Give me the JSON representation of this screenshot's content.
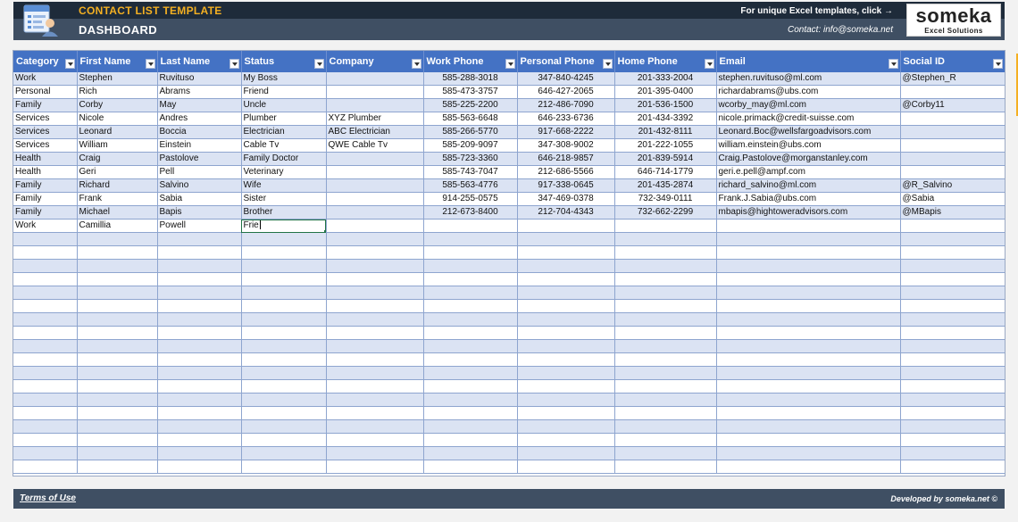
{
  "header": {
    "template_title": "CONTACT LIST TEMPLATE",
    "dashboard_title": "DASHBOARD",
    "promo_text": "For unique Excel templates, click →",
    "contact_text": "Contact: info@someka.net",
    "brand_name": "someka",
    "brand_sub": "Excel Solutions",
    "logo_icon": "contact-card-icon"
  },
  "table": {
    "columns": [
      "Category",
      "First Name",
      "Last Name",
      "Status",
      "Company",
      "Work Phone",
      "Personal Phone",
      "Home Phone",
      "Email",
      "Social ID"
    ],
    "rows": [
      [
        "Work",
        "Stephen",
        "Ruvituso",
        "My Boss",
        "",
        "585-288-3018",
        "347-840-4245",
        "201-333-2004",
        "stephen.ruvituso@ml.com",
        "@Stephen_R"
      ],
      [
        "Personal",
        "Rich",
        "Abrams",
        "Friend",
        "",
        "585-473-3757",
        "646-427-2065",
        "201-395-0400",
        "richardabrams@ubs.com",
        ""
      ],
      [
        "Family",
        "Corby",
        "May",
        "Uncle",
        "",
        "585-225-2200",
        "212-486-7090",
        "201-536-1500",
        "wcorby_may@ml.com",
        "@Corby11"
      ],
      [
        "Services",
        "Nicole",
        "Andres",
        "Plumber",
        "XYZ Plumber",
        "585-563-6648",
        "646-233-6736",
        "201-434-3392",
        "nicole.primack@credit-suisse.com",
        ""
      ],
      [
        "Services",
        "Leonard",
        "Boccia",
        "Electrician",
        "ABC Electrician",
        "585-266-5770",
        "917-668-2222",
        "201-432-8111",
        "Leonard.Boc@wellsfargoadvisors.com",
        ""
      ],
      [
        "Services",
        "William",
        "Einstein",
        "Cable Tv",
        "QWE Cable Tv",
        "585-209-9097",
        "347-308-9002",
        "201-222-1055",
        "william.einstein@ubs.com",
        ""
      ],
      [
        "Health",
        "Craig",
        "Pastolove",
        "Family Doctor",
        "",
        "585-723-3360",
        "646-218-9857",
        "201-839-5914",
        "Craig.Pastolove@morganstanley.com",
        ""
      ],
      [
        "Health",
        "Geri",
        "Pell",
        "Veterinary",
        "",
        "585-743-7047",
        "212-686-5566",
        "646-714-1779",
        "geri.e.pell@ampf.com",
        ""
      ],
      [
        "Family",
        "Richard",
        "Salvino",
        "Wife",
        "",
        "585-563-4776",
        "917-338-0645",
        "201-435-2874",
        "richard_salvino@ml.com",
        "@R_Salvino"
      ],
      [
        "Family",
        "Frank",
        "Sabia",
        "Sister",
        "",
        "914-255-0575",
        "347-469-0378",
        "732-349-0111",
        "Frank.J.Sabia@ubs.com",
        "@Sabia"
      ],
      [
        "Family",
        "Michael",
        "Bapis",
        "Brother",
        "",
        "212-673-8400",
        "212-704-4343",
        "732-662-2299",
        "mbapis@hightoweradvisors.com",
        "@MBapis"
      ],
      [
        "Work",
        "Camillia",
        "Powell",
        "Frie",
        "",
        "",
        "",
        "",
        "",
        ""
      ]
    ],
    "empty_rows": 18
  },
  "footer": {
    "terms_label": "Terms of Use",
    "developed_by": "Developed by someka.net ©"
  },
  "colors": {
    "header_dark": "#1e2b3a",
    "header_band": "#3f4f63",
    "accent_orange": "#f4b022",
    "table_header": "#4472c4",
    "row_alt": "#dbe3f3"
  }
}
